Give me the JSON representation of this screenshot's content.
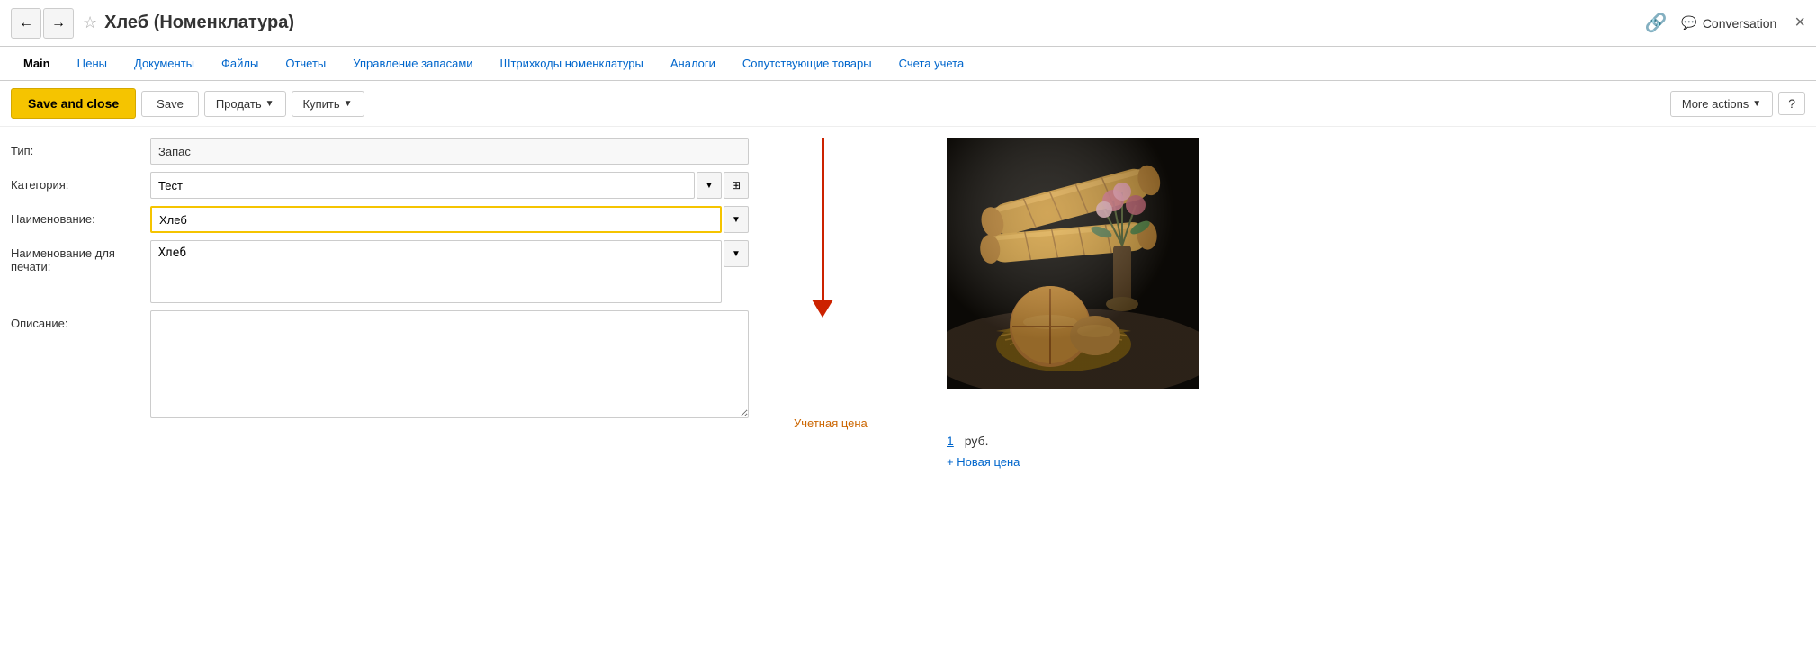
{
  "header": {
    "title": "Хлеб (Номенклатура)",
    "conversation_label": "Conversation",
    "star_icon": "☆",
    "link_icon": "🔗",
    "chat_icon": "💬",
    "close_icon": "×"
  },
  "tabs": [
    {
      "label": "Main",
      "active": true
    },
    {
      "label": "Цены",
      "active": false
    },
    {
      "label": "Документы",
      "active": false
    },
    {
      "label": "Файлы",
      "active": false
    },
    {
      "label": "Отчеты",
      "active": false
    },
    {
      "label": "Управление запасами",
      "active": false
    },
    {
      "label": "Штрихкоды номенклатуры",
      "active": false
    },
    {
      "label": "Аналоги",
      "active": false
    },
    {
      "label": "Сопутствующие товары",
      "active": false
    },
    {
      "label": "Счета учета",
      "active": false
    }
  ],
  "toolbar": {
    "save_close_label": "Save and close",
    "save_label": "Save",
    "sell_label": "Продать",
    "buy_label": "Купить",
    "more_actions_label": "More actions",
    "help_label": "?"
  },
  "form": {
    "type_label": "Тип:",
    "type_value": "Запас",
    "category_label": "Категория:",
    "category_value": "Тест",
    "name_label": "Наименование:",
    "name_value": "Хлеб",
    "print_name_label": "Наименование для печати:",
    "print_name_value": "Хлеб",
    "description_label": "Описание:",
    "description_value": ""
  },
  "pricing": {
    "учетная_цена_label": "Учетная цена",
    "price_value": "1",
    "currency": "руб.",
    "new_price_label": "+ Новая цена"
  },
  "colors": {
    "accent": "#f5c400",
    "link": "#0066cc",
    "arrow": "#cc2200",
    "orange_label": "#cc6600"
  }
}
